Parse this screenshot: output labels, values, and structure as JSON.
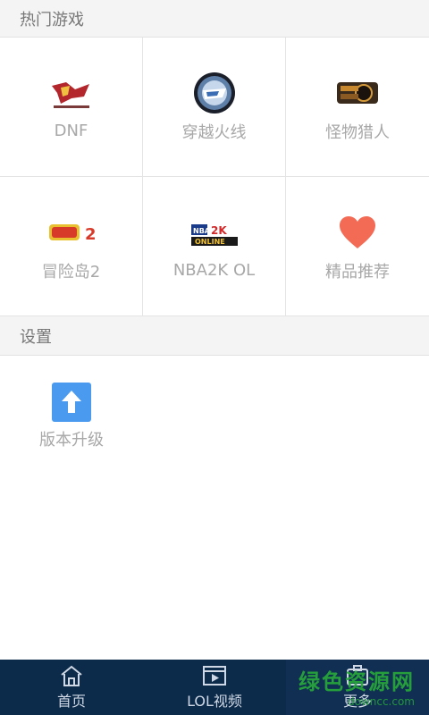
{
  "sections": {
    "hot_games_title": "热门游戏",
    "settings_title": "设置"
  },
  "games": [
    {
      "label": "DNF",
      "icon": "dnf-logo-icon"
    },
    {
      "label": "穿越火线",
      "icon": "crossfire-logo-icon"
    },
    {
      "label": "怪物猎人",
      "icon": "monster-hunter-logo-icon"
    },
    {
      "label": "冒险岛2",
      "icon": "maplestory2-logo-icon"
    },
    {
      "label": "NBA2K OL",
      "icon": "nba2k-online-logo-icon"
    },
    {
      "label": "精品推荐",
      "icon": "heart-icon"
    }
  ],
  "settings": {
    "items": [
      {
        "label": "版本升级",
        "icon": "upload-arrow-icon"
      }
    ]
  },
  "tabbar": {
    "tabs": [
      {
        "label": "首页",
        "icon": "home-icon"
      },
      {
        "label": "LOL视频",
        "icon": "video-icon"
      },
      {
        "label": "更多",
        "icon": "more-icon",
        "active": true
      }
    ]
  },
  "logo_text": {
    "nba": "NBA",
    "two_k": "2K",
    "online": "ONLINE",
    "maple_digit": "2"
  },
  "watermark": {
    "line1": "绿色资源网",
    "line2": "downcc.com"
  },
  "colors": {
    "tabbar_bg": "#0c2a4a",
    "heart": "#f36b55",
    "upgrade_blue": "#4a9af0",
    "label_gray": "#a8a8a8"
  }
}
